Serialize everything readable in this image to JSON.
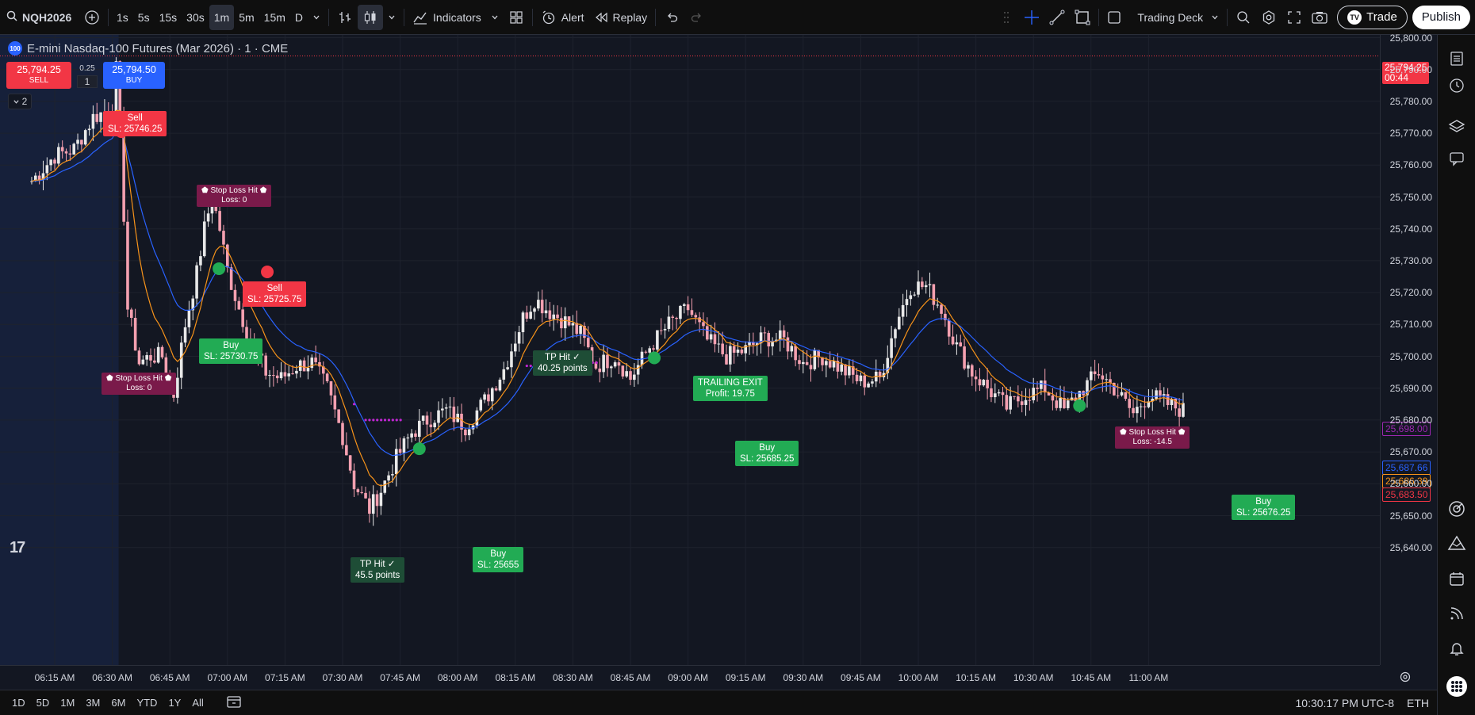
{
  "toolbar": {
    "symbol": "NQH2026",
    "intervals": [
      "1s",
      "5s",
      "15s",
      "30s",
      "1m",
      "5m",
      "15m",
      "D"
    ],
    "active_interval": "1m",
    "indicators_label": "Indicators",
    "alert_label": "Alert",
    "replay_label": "Replay",
    "trading_deck_label": "Trading Deck",
    "trade_label": "Trade",
    "publish_label": "Publish"
  },
  "legend": {
    "logo_text": "100",
    "title": "E-mini Nasdaq-100 Futures (Mar 2026) · 1 · CME"
  },
  "order_panel": {
    "sell_price": "25,794.25",
    "sell_label": "SELL",
    "spread": "0.25",
    "quantity": "1",
    "buy_price": "25,794.50",
    "buy_label": "BUY",
    "collapse_count": "2"
  },
  "signals": [
    {
      "type": "sell",
      "line1": "Sell",
      "line2": "SL: 25746.25"
    },
    {
      "type": "sl",
      "line1": "⬟ Stop Loss Hit ⬟",
      "line2": "Loss: 0"
    },
    {
      "type": "sell",
      "line1": "Sell",
      "line2": "SL: 25725.75"
    },
    {
      "type": "buy",
      "line1": "Buy",
      "line2": "SL: 25730.75"
    },
    {
      "type": "sl",
      "line1": "⬟ Stop Loss Hit ⬟",
      "line2": "Loss: 0"
    },
    {
      "type": "tp",
      "line1": "TP Hit ✓",
      "line2": "40.25 points"
    },
    {
      "type": "trail",
      "line1": "TRAILING EXIT",
      "line2": "Profit: 19.75"
    },
    {
      "type": "buy",
      "line1": "Buy",
      "line2": "SL: 25685.25"
    },
    {
      "type": "tp",
      "line1": "TP Hit ✓",
      "line2": "45.5 points"
    },
    {
      "type": "buy",
      "line1": "Buy",
      "line2": "SL: 25655"
    },
    {
      "type": "sl",
      "line1": "⬟ Stop Loss Hit ⬟",
      "line2": "Loss: -14.5"
    },
    {
      "type": "buy",
      "line1": "Buy",
      "line2": "SL: 25676.25"
    }
  ],
  "price_axis": {
    "ticks": [
      "25,800.00",
      "25,790.00",
      "25,780.00",
      "25,770.00",
      "25,760.00",
      "25,750.00",
      "25,740.00",
      "25,730.00",
      "25,720.00",
      "25,710.00",
      "25,700.00",
      "25,690.00",
      "25,680.00",
      "25,670.00",
      "25,660.00",
      "25,650.00",
      "25,640.00"
    ],
    "current_price": "25,794.25",
    "countdown": "00:44",
    "tags": [
      {
        "value": "25,698.00",
        "color": "#9c27b0"
      },
      {
        "value": "25,687.66",
        "color": "#2962ff"
      },
      {
        "value": "25,686.39",
        "color": "#f7931a"
      },
      {
        "value": "25,683.50",
        "color": "#f23645"
      }
    ]
  },
  "time_axis": {
    "ticks": [
      "06:15 AM",
      "06:30 AM",
      "06:45 AM",
      "07:00 AM",
      "07:15 AM",
      "07:30 AM",
      "07:45 AM",
      "08:00 AM",
      "08:15 AM",
      "08:30 AM",
      "08:45 AM",
      "09:00 AM",
      "09:15 AM",
      "09:30 AM",
      "09:45 AM",
      "10:00 AM",
      "10:15 AM",
      "10:30 AM",
      "10:45 AM",
      "11:00 AM"
    ]
  },
  "bottombar": {
    "ranges": [
      "1D",
      "5D",
      "1M",
      "3M",
      "6M",
      "YTD",
      "1Y",
      "All"
    ],
    "clock": "10:30:17 PM UTC-8",
    "session": "ETH"
  },
  "colors": {
    "background": "#131722",
    "up_candle": "#e8e8e8",
    "down_candle": "#f4a0b0",
    "ema_fast": "#f7931a",
    "ema_slow": "#2962ff",
    "sell": "#f23645",
    "buy": "#22ab54"
  },
  "chart_data": {
    "type": "candlestick",
    "y_range": [
      25637,
      25801
    ],
    "x_range_label": [
      "06:15 AM",
      "11:00 AM"
    ],
    "series": [
      {
        "type": "candles",
        "close_path": [
          [
            "06:09",
            25755
          ],
          [
            "06:15",
            25763
          ],
          [
            "06:20",
            25765
          ],
          [
            "06:25",
            25775
          ],
          [
            "06:30",
            25778
          ],
          [
            "06:31",
            25790
          ],
          [
            "06:32",
            25774
          ],
          [
            "06:34",
            25715
          ],
          [
            "06:37",
            25698
          ],
          [
            "06:40",
            25700
          ],
          [
            "06:43",
            25700
          ],
          [
            "06:46",
            25688
          ],
          [
            "06:49",
            25710
          ],
          [
            "06:52",
            25726
          ],
          [
            "06:54",
            25740
          ],
          [
            "06:56",
            25750
          ],
          [
            "06:58",
            25740
          ],
          [
            "07:00",
            25727
          ],
          [
            "07:03",
            25715
          ],
          [
            "07:06",
            25705
          ],
          [
            "07:10",
            25695
          ],
          [
            "07:14",
            25693
          ],
          [
            "07:18",
            25697
          ],
          [
            "07:22",
            25698
          ],
          [
            "07:26",
            25690
          ],
          [
            "07:30",
            25675
          ],
          [
            "07:33",
            25660
          ],
          [
            "07:37",
            25652
          ],
          [
            "07:40",
            25658
          ],
          [
            "07:44",
            25668
          ],
          [
            "07:48",
            25676
          ],
          [
            "07:52",
            25680
          ],
          [
            "07:57",
            25683
          ],
          [
            "08:02",
            25678
          ],
          [
            "08:07",
            25686
          ],
          [
            "08:12",
            25696
          ],
          [
            "08:17",
            25712
          ],
          [
            "08:20",
            25718
          ],
          [
            "08:24",
            25714
          ],
          [
            "08:28",
            25711
          ],
          [
            "08:32",
            25707
          ],
          [
            "08:36",
            25697
          ],
          [
            "08:41",
            25700
          ],
          [
            "08:45",
            25693
          ],
          [
            "08:50",
            25703
          ],
          [
            "08:55",
            25710
          ],
          [
            "09:00",
            25715
          ],
          [
            "09:05",
            25705
          ],
          [
            "09:10",
            25700
          ],
          [
            "09:15",
            25702
          ],
          [
            "09:20",
            25706
          ],
          [
            "09:25",
            25705
          ],
          [
            "09:30",
            25698
          ],
          [
            "09:35",
            25700
          ],
          [
            "09:40",
            25696
          ],
          [
            "09:45",
            25692
          ],
          [
            "09:50",
            25693
          ],
          [
            "09:54",
            25710
          ],
          [
            "09:58",
            25722
          ],
          [
            "10:02",
            25722
          ],
          [
            "10:06",
            25715
          ],
          [
            "10:10",
            25703
          ],
          [
            "10:14",
            25695
          ],
          [
            "10:18",
            25690
          ],
          [
            "10:23",
            25684
          ],
          [
            "10:28",
            25688
          ],
          [
            "10:33",
            25690
          ],
          [
            "10:38",
            25683
          ],
          [
            "10:43",
            25690
          ],
          [
            "10:47",
            25695
          ],
          [
            "10:51",
            25690
          ],
          [
            "10:56",
            25682
          ],
          [
            "11:00",
            25688
          ],
          [
            "11:05",
            25685
          ],
          [
            "11:09",
            25683
          ]
        ]
      },
      {
        "name": "",
        "type": "line",
        "color": "#f7931a",
        "kind": "fast moving average"
      },
      {
        "name": "",
        "type": "line",
        "color": "#2962ff",
        "kind": "slow moving average"
      }
    ]
  }
}
